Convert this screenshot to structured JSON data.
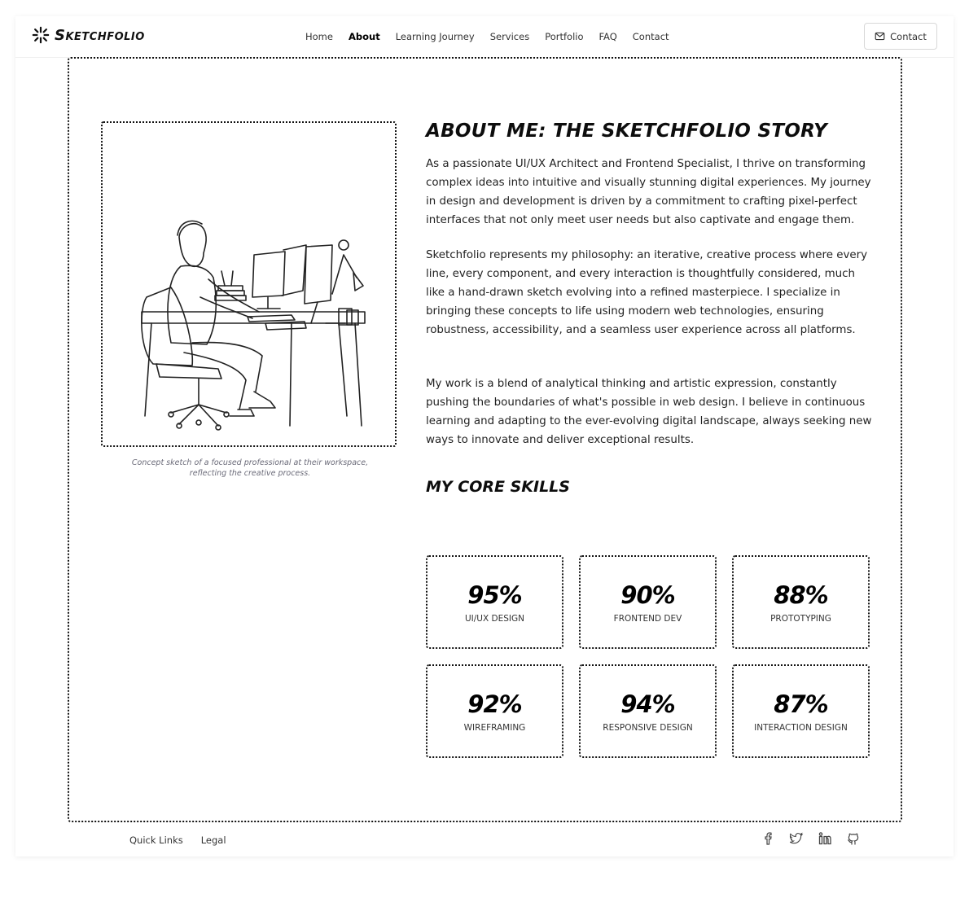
{
  "brand": {
    "name": "Sketchfolio"
  },
  "nav": {
    "items": [
      {
        "label": "Home",
        "active": false
      },
      {
        "label": "About",
        "active": true
      },
      {
        "label": "Learning Journey",
        "active": false
      },
      {
        "label": "Services",
        "active": false
      },
      {
        "label": "Portfolio",
        "active": false
      },
      {
        "label": "FAQ",
        "active": false
      },
      {
        "label": "Contact",
        "active": false
      }
    ],
    "contact_button": "Contact"
  },
  "about": {
    "title": "About Me: The Sketchfolio Story",
    "paragraphs": [
      "As a passionate UI/UX Architect and Frontend Specialist, I thrive on transforming complex ideas into intuitive and visually stunning digital experiences. My journey in design and development is driven by a commitment to crafting pixel-perfect interfaces that not only meet user needs but also captivate and engage them.",
      "Sketchfolio represents my philosophy: an iterative, creative process where every line, every component, and every interaction is thoughtfully considered, much like a hand-drawn sketch evolving into a refined masterpiece. I specialize in bringing these concepts to life using modern web technologies, ensuring robustness, accessibility, and a seamless user experience across all platforms.",
      "My work is a blend of analytical thinking and artistic expression, constantly pushing the boundaries of what's possible in web design. I believe in continuous learning and adapting to the ever-evolving digital landscape, always seeking new ways to innovate and deliver exceptional results."
    ],
    "image_caption": "Concept sketch of a focused professional at their workspace, reflecting the creative process."
  },
  "skills": {
    "title": "My Core Skills",
    "items": [
      {
        "value": "95%",
        "label": "UI/UX Design"
      },
      {
        "value": "90%",
        "label": "Frontend Dev"
      },
      {
        "value": "88%",
        "label": "Prototyping"
      },
      {
        "value": "92%",
        "label": "Wireframing"
      },
      {
        "value": "94%",
        "label": "Responsive Design"
      },
      {
        "value": "87%",
        "label": "Interaction Design"
      }
    ]
  },
  "footer": {
    "links": [
      "Quick Links",
      "Legal"
    ],
    "socials": [
      "facebook-icon",
      "twitter-icon",
      "linkedin-icon",
      "github-icon"
    ]
  },
  "colors": {
    "ink": "#111111",
    "caption": "#6a6a78",
    "text": "#222222"
  }
}
